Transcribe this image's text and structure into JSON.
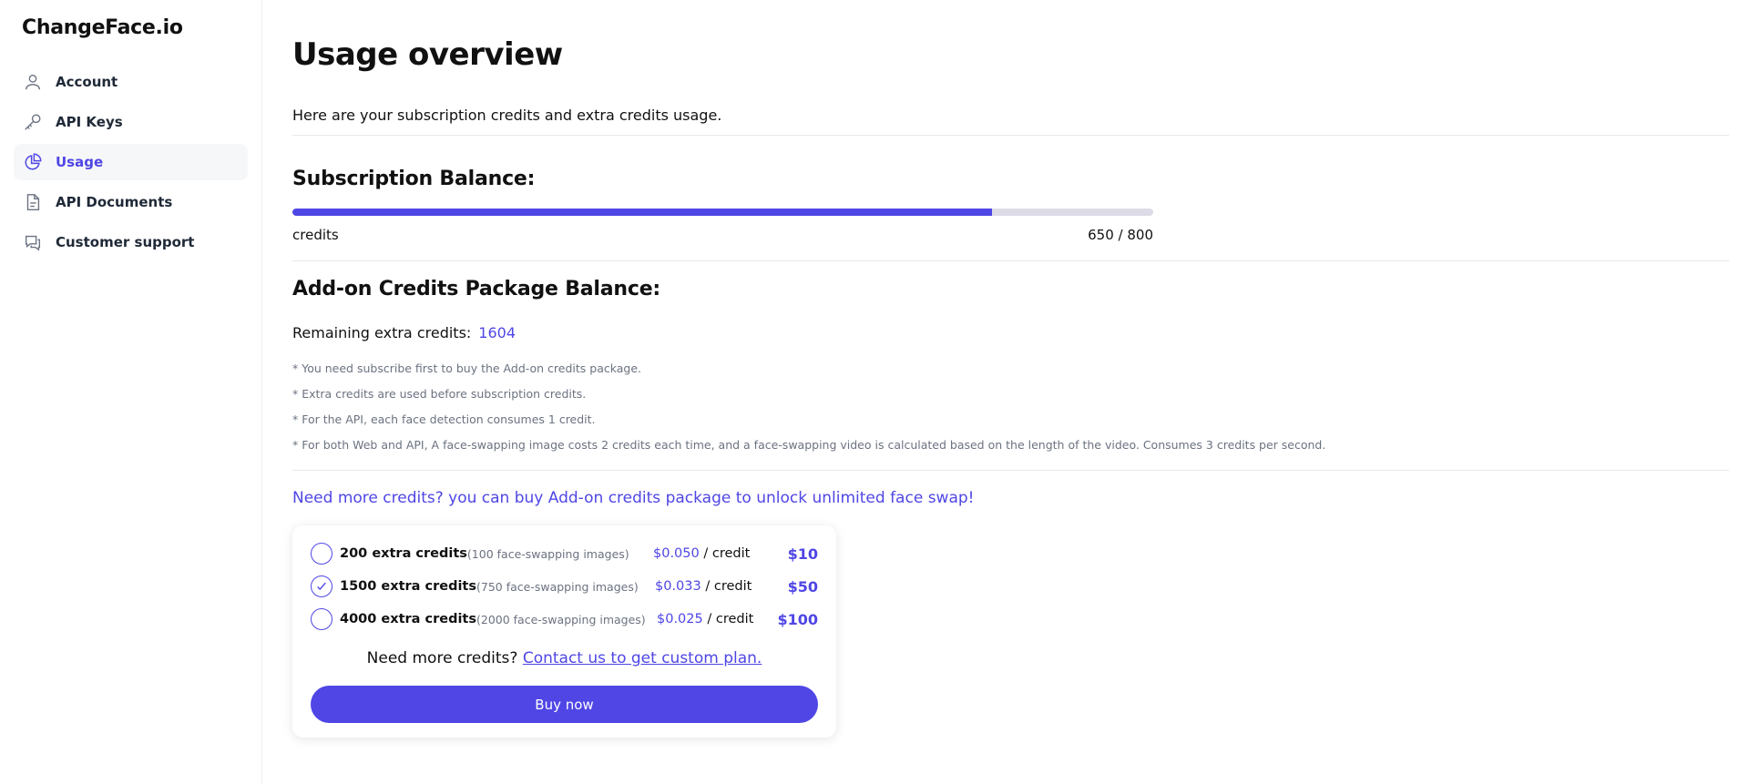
{
  "brand": "ChangeFace.io",
  "sidebar": {
    "items": [
      {
        "label": "Account",
        "icon": "user-icon"
      },
      {
        "label": "API Keys",
        "icon": "key-icon"
      },
      {
        "label": "Usage",
        "icon": "pie-chart-icon",
        "active": true
      },
      {
        "label": "API Documents",
        "icon": "document-icon"
      },
      {
        "label": "Customer support",
        "icon": "chat-icon"
      }
    ]
  },
  "main": {
    "title": "Usage overview",
    "subtitle": "Here are your subscription credits and extra credits usage.",
    "subscription": {
      "title": "Subscription Balance:",
      "label": "credits",
      "value_text": "650 / 800",
      "used": 650,
      "total": 800
    },
    "addon": {
      "title": "Add-on Credits Package Balance:",
      "remaining_label": "Remaining extra credits:",
      "remaining_value": "1604",
      "notes": [
        "* You need subscribe first to buy the Add-on credits package.",
        "* Extra credits are used before subscription credits.",
        "* For the API, each face detection consumes 1 credit.",
        "* For both Web and API, A face-swapping image costs 2 credits each time, and a face-swapping video is calculated based on the length of the video. Consumes 3 credits per second."
      ]
    },
    "promo": "Need more credits? you can buy Add-on credits package to unlock unlimited face swap!",
    "packages": [
      {
        "credits": "200 extra credits",
        "desc": "(100 face-swapping images)",
        "price": "$0.050",
        "unit": " / credit",
        "total": "$10",
        "selected": false
      },
      {
        "credits": "1500 extra credits",
        "desc": "(750 face-swapping images)",
        "price": "$0.033",
        "unit": " / credit",
        "total": "$50",
        "selected": true
      },
      {
        "credits": "4000 extra credits",
        "desc": "(2000 face-swapping images)",
        "price": "$0.025",
        "unit": " / credit",
        "total": "$100",
        "selected": false
      }
    ],
    "contact_prefix": "Need more credits? ",
    "contact_link": "Contact us to get custom plan.",
    "buy_label": "Buy now"
  },
  "colors": {
    "accent": "#4f46e5",
    "track": "#dcdbe6",
    "muted": "#6b7280"
  }
}
